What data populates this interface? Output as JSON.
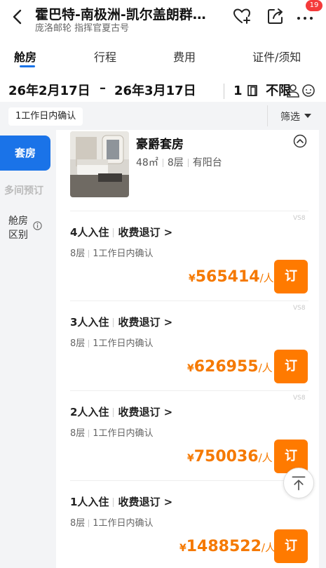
{
  "header": {
    "title": "霍巴特-南极洲-凯尔盖朗群…",
    "subtitle": "庞洛邮轮 指挥官夏古号",
    "badge_count": "19"
  },
  "tabs": [
    {
      "label": "舱房",
      "active": true
    },
    {
      "label": "行程",
      "active": false
    },
    {
      "label": "费用",
      "active": false
    },
    {
      "label": "证件/须知",
      "active": false
    }
  ],
  "date_bar": {
    "start": "26年2月17日",
    "separator": "–",
    "end": "26年3月17日",
    "cabins": "1",
    "guests": "不限"
  },
  "confirm_chip": "1工作日内确认",
  "filter_label": "筛选",
  "sidebar": {
    "active_label": "套房",
    "disabled_label": "多间预订",
    "item_label_line1": "舱房",
    "item_label_line2": "区别"
  },
  "room": {
    "name": "豪爵套房",
    "area": "48㎡",
    "deck": "8层",
    "balcony": "有阳台"
  },
  "offers": [
    {
      "tag": "VS8",
      "occupancy": "4人入住",
      "policy": "收费退订 >",
      "deck": "8层",
      "confirm": "1工作日内确认",
      "currency": "¥",
      "price": "565414",
      "unit": "/人",
      "button": "订"
    },
    {
      "tag": "VS8",
      "occupancy": "3人入住",
      "policy": "收费退订 >",
      "deck": "8层",
      "confirm": "1工作日内确认",
      "currency": "¥",
      "price": "626955",
      "unit": "/人",
      "button": "订"
    },
    {
      "tag": "VS8",
      "occupancy": "2人入住",
      "policy": "收费退订 >",
      "deck": "8层",
      "confirm": "1工作日内确认",
      "currency": "¥",
      "price": "750036",
      "unit": "/人",
      "button": "订"
    },
    {
      "tag": "",
      "occupancy": "1人入住",
      "policy": "收费退订 >",
      "deck": "8层",
      "confirm": "1工作日内确认",
      "currency": "¥",
      "price": "1488522",
      "unit": "/人",
      "button": "订"
    }
  ],
  "colors": {
    "accent_blue": "#1a73e8",
    "price_orange": "#f57900",
    "button_orange": "#ff7a00",
    "badge_red": "#f43a3a"
  }
}
